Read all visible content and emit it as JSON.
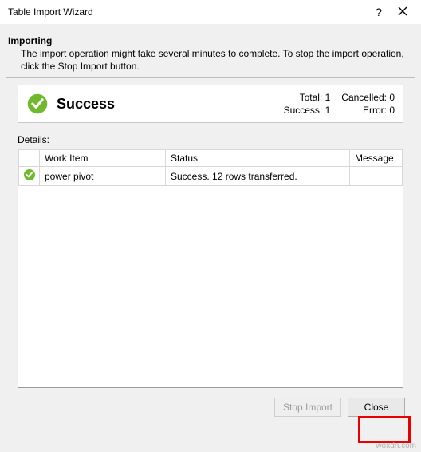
{
  "titlebar": {
    "title": "Table Import Wizard"
  },
  "header": {
    "heading": "Importing",
    "description": "The import operation might take several minutes to complete. To stop the import operation, click the Stop Import button."
  },
  "success": {
    "label": "Success",
    "stats": {
      "total_label": "Total: 1",
      "cancelled_label": "Cancelled: 0",
      "success_label": "Success: 1",
      "error_label": "Error: 0"
    }
  },
  "details": {
    "label": "Details:",
    "columns": {
      "work": "Work Item",
      "status": "Status",
      "message": "Message"
    },
    "rows": [
      {
        "work": "power pivot",
        "status": "Success. 12 rows transferred.",
        "message": ""
      }
    ]
  },
  "footer": {
    "stop_label": "Stop Import",
    "close_label": "Close"
  },
  "watermark": "woxdn.com"
}
